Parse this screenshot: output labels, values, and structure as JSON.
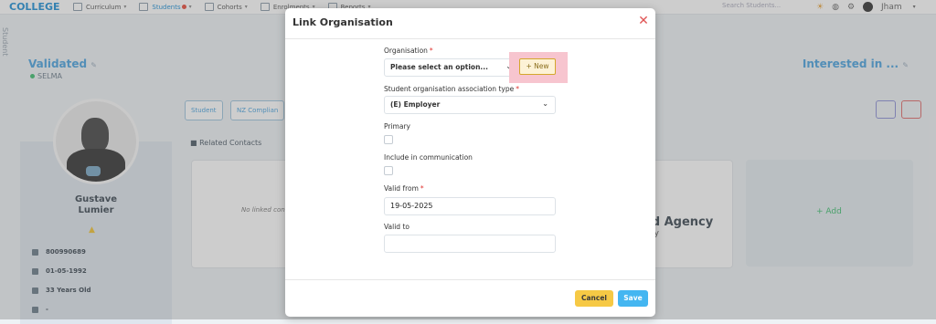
{
  "app": {
    "logo": "COLLEGE",
    "nav": [
      {
        "label": "Curriculum"
      },
      {
        "label": "Students"
      },
      {
        "label": "Cohorts"
      },
      {
        "label": "Enrolments"
      },
      {
        "label": "Reports"
      }
    ],
    "search_placeholder": "Search Students...",
    "user_name": "Jham",
    "side_label": "Student",
    "status_title": "Validated",
    "status_sub": "SELMA",
    "right_title": "Interested in ...",
    "tabs": [
      "Student",
      "NZ Complian"
    ],
    "related_heading": "Related Contacts",
    "no_linked": "No linked con",
    "agency_name": "ad Agency",
    "agency_sub": "ncy",
    "add_label": "+ Add",
    "student_first": "Gustave",
    "student_last": "Lumier",
    "student_id": "800990689",
    "dob": "01-05-1992",
    "age": "33 Years Old",
    "extra": "-",
    "accent_color": "#4aa3df"
  },
  "modal": {
    "title": "Link Organisation",
    "organisation_label": "Organisation",
    "organisation_placeholder": "Please select an option...",
    "new_label": "+ New",
    "assoc_type_label": "Student organisation association type",
    "assoc_type_value": "(E) Employer",
    "primary_label": "Primary",
    "include_comm_label": "Include in communication",
    "valid_from_label": "Valid from",
    "valid_from_value": "19-05-2025",
    "valid_to_label": "Valid to",
    "valid_to_value": "",
    "cancel_label": "Cancel",
    "save_label": "Save",
    "required_mark": "*"
  }
}
